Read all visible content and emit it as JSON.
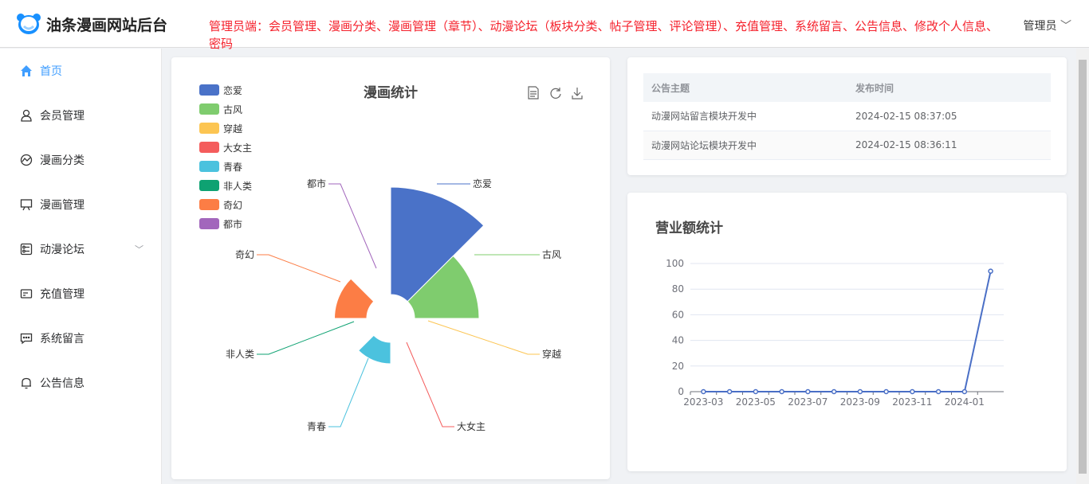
{
  "header": {
    "title": "油条漫画网站后台",
    "notice": "管理员端：会员管理、漫画分类、漫画管理（章节）、动漫论坛（板块分类、帖子管理、评论管理）、充值管理、系统留言、公告信息、修改个人信息、密码",
    "user": "管理员"
  },
  "sidebar": {
    "items": [
      {
        "label": "首页",
        "icon": "home-icon"
      },
      {
        "label": "会员管理",
        "icon": "user-icon"
      },
      {
        "label": "漫画分类",
        "icon": "chart-icon"
      },
      {
        "label": "漫画管理",
        "icon": "board-icon"
      },
      {
        "label": "动漫论坛",
        "icon": "forum-icon"
      },
      {
        "label": "充值管理",
        "icon": "card-icon"
      },
      {
        "label": "系统留言",
        "icon": "message-icon"
      },
      {
        "label": "公告信息",
        "icon": "bell-icon"
      }
    ]
  },
  "announcements": {
    "columns": [
      "公告主题",
      "发布时间"
    ],
    "rows": [
      [
        "动漫网站留言模块开发中",
        "2024-02-15 08:37:05"
      ],
      [
        "动漫网站论坛模块开发中",
        "2024-02-15 08:36:11"
      ]
    ]
  },
  "chart_data": [
    {
      "type": "pie",
      "rose": true,
      "title": "漫画统计",
      "categories": [
        "恋爱",
        "古风",
        "穿越",
        "大女主",
        "青春",
        "非人类",
        "奇幻",
        "都市"
      ],
      "values": [
        10,
        6,
        0,
        0,
        2,
        0,
        3,
        0
      ],
      "colors": [
        "#4a72c8",
        "#7fcc6e",
        "#fcc552",
        "#f45c5c",
        "#4bc2de",
        "#0ea272",
        "#fc7d45",
        "#a266bc"
      ],
      "legend": "top-left",
      "toolbox": [
        "data-view-icon",
        "refresh-icon",
        "download-icon"
      ]
    },
    {
      "type": "line",
      "title": "营业额统计",
      "x": [
        "2023-03",
        "2023-04",
        "2023-05",
        "2023-06",
        "2023-07",
        "2023-08",
        "2023-09",
        "2023-10",
        "2023-11",
        "2023-12",
        "2024-01",
        "2024-02"
      ],
      "x_tick_labels": [
        "2023-03",
        "2023-05",
        "2023-07",
        "2023-09",
        "2023-11",
        "2024-01"
      ],
      "values": [
        0,
        0,
        0,
        0,
        0,
        0,
        0,
        0,
        0,
        0,
        0,
        94
      ],
      "yticks": [
        0,
        20,
        40,
        60,
        80,
        100
      ],
      "ylim": [
        0,
        100
      ],
      "color": "#4a6fc6"
    }
  ]
}
